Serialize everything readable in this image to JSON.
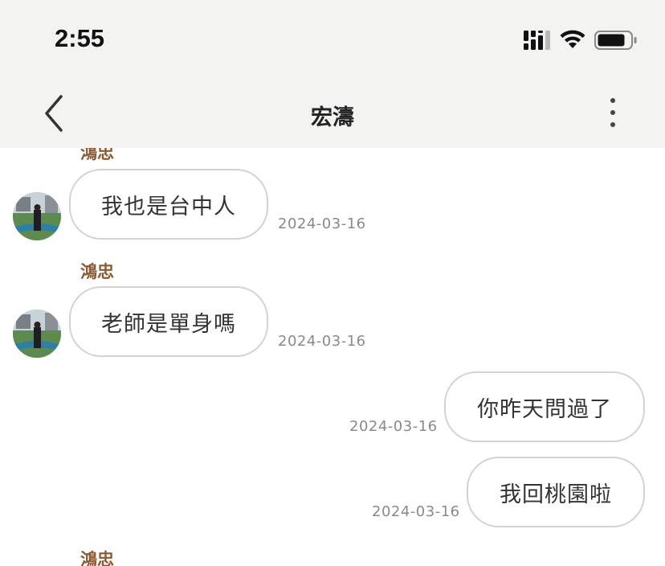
{
  "status_bar": {
    "time": "2:55"
  },
  "header": {
    "title": "宏濤"
  },
  "messages": [
    {
      "sender": "鴻忠",
      "text": "我也是台中人",
      "date": "2024-03-16"
    },
    {
      "sender": "鴻忠",
      "text": "老師是單身嗎",
      "date": "2024-03-16"
    },
    {
      "sender": "",
      "text": "你昨天問過了",
      "date": "2024-03-16"
    },
    {
      "sender": "",
      "text": "我回桃園啦",
      "date": "2024-03-16"
    },
    {
      "sender": "鴻忠",
      "text": "",
      "date": ""
    }
  ],
  "icons": {
    "back": "chevron-left-icon",
    "more": "vertical-dots-icon",
    "signal": "cellular-signal-icon",
    "wifi": "wifi-icon",
    "battery": "battery-icon"
  },
  "colors": {
    "header_bg": "#f3f3f1",
    "sender_name": "#8a5a34",
    "bubble_border": "#d3d3d3",
    "timestamp": "#8a8a8a"
  }
}
